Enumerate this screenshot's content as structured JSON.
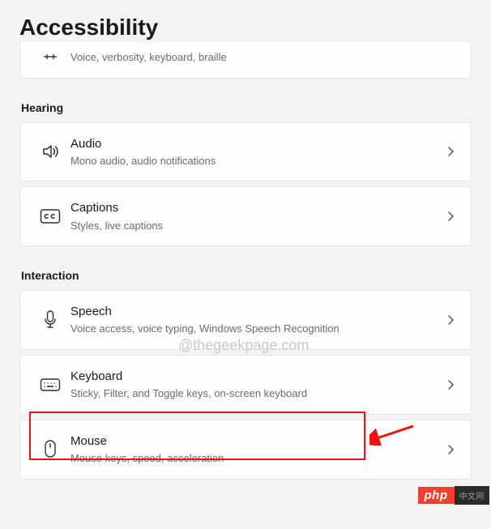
{
  "page": {
    "title": "Accessibility"
  },
  "top_partial": {
    "subtitle": "Voice, verbosity, keyboard, braille"
  },
  "sections": {
    "hearing": {
      "label": "Hearing",
      "items": {
        "audio": {
          "title": "Audio",
          "subtitle": "Mono audio, audio notifications"
        },
        "captions": {
          "title": "Captions",
          "subtitle": "Styles, live captions"
        }
      }
    },
    "interaction": {
      "label": "Interaction",
      "items": {
        "speech": {
          "title": "Speech",
          "subtitle": "Voice access, voice typing, Windows Speech Recognition"
        },
        "keyboard": {
          "title": "Keyboard",
          "subtitle": "Sticky, Filter, and Toggle keys, on-screen keyboard"
        },
        "mouse": {
          "title": "Mouse",
          "subtitle": "Mouse keys, speed, acceleration"
        }
      }
    }
  },
  "watermark": "@thegeekpage.com",
  "badge": {
    "left": "php",
    "right": "中文网"
  },
  "annotation": {
    "highlight_target": "keyboard",
    "arrow_color": "#e11"
  }
}
